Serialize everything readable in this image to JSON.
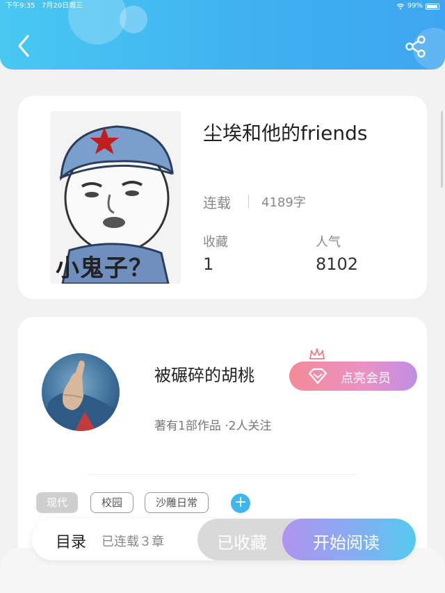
{
  "status_bar": {
    "time": "下午9:35",
    "date": "7月20日周三",
    "battery": "99%"
  },
  "header": {
    "back_icon": "chevron-left-icon",
    "share_icon": "share-icon"
  },
  "book": {
    "title": "尘埃和他的friends",
    "cover_caption": "小鬼子？",
    "status": "连载",
    "word_count": "4189字",
    "favorites_label": "收藏",
    "favorites_value": "1",
    "popularity_label": "人气",
    "popularity_value": "8102"
  },
  "author": {
    "name": "被碾碎的胡桃",
    "vip_button": "点亮会员",
    "meta": "著有1部作品 ·2人关注"
  },
  "tags": [
    "现代",
    "校园",
    "沙雕日常"
  ],
  "add_tag_label": "+",
  "bottom_bar": {
    "catalog": "目录",
    "chapters": "已连载３章",
    "collected": "已收藏",
    "start_reading": "开始阅读"
  },
  "colors": {
    "header_blue": "#3fb0f0",
    "accent_blue": "#3fb7ee",
    "vip_pink": "#f58a98",
    "vip_purple": "#bf8de6"
  }
}
